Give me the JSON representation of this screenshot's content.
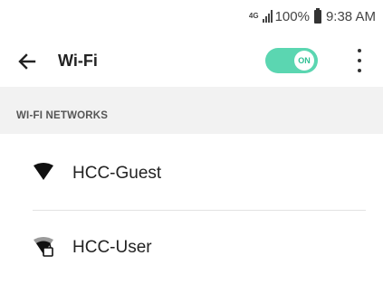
{
  "status_bar": {
    "network_badge": "4G",
    "battery": "100%",
    "time": "9:38 AM"
  },
  "app_bar": {
    "title": "Wi-Fi",
    "toggle_label": "ON",
    "toggle_on": true
  },
  "section": {
    "title": "WI-FI NETWORKS"
  },
  "networks": [
    {
      "name": "HCC-Guest",
      "icon": "wifi-open-icon",
      "locked": false
    },
    {
      "name": "HCC-User",
      "icon": "wifi-lock-icon",
      "locked": true
    }
  ],
  "colors": {
    "toggle_track": "#5bd6b1",
    "toggle_knob_text": "#2fbf93",
    "header_bg": "#f2f2f2"
  }
}
